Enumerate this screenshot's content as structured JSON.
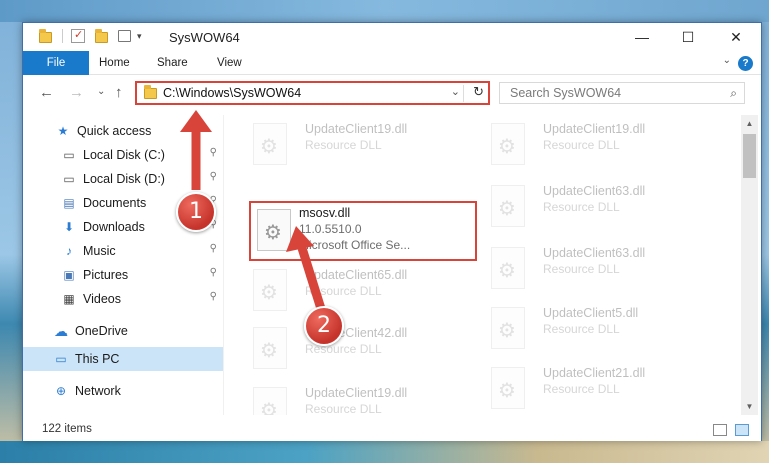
{
  "window": {
    "title": "SysWOW64",
    "minimize": "—",
    "maximize": "☐",
    "close": "✕"
  },
  "ribbon": {
    "tabs": [
      "File",
      "Home",
      "Share",
      "View"
    ],
    "help": "?"
  },
  "navigation": {
    "back": "←",
    "forward": "→",
    "recent": "⌄",
    "up": "↑",
    "address": "C:\\Windows\\SysWOW64",
    "address_dropdown": "⌄",
    "refresh": "↻",
    "search_placeholder": "Search SysWOW64",
    "search_icon": "⌕"
  },
  "sidebar": {
    "items": [
      {
        "label": "Quick access",
        "icon": "star-icon",
        "glyph": "★",
        "pinned": false
      },
      {
        "label": "Local Disk (C:)",
        "icon": "drive-icon",
        "glyph": "▭",
        "pinned": true
      },
      {
        "label": "Local Disk (D:)",
        "icon": "drive-icon",
        "glyph": "▭",
        "pinned": true
      },
      {
        "label": "Documents",
        "icon": "documents-icon",
        "glyph": "▤",
        "pinned": true
      },
      {
        "label": "Downloads",
        "icon": "downloads-icon",
        "glyph": "⬇",
        "pinned": true
      },
      {
        "label": "Music",
        "icon": "music-icon",
        "glyph": "♪",
        "pinned": true
      },
      {
        "label": "Pictures",
        "icon": "pictures-icon",
        "glyph": "▣",
        "pinned": true
      },
      {
        "label": "Videos",
        "icon": "videos-icon",
        "glyph": "▦",
        "pinned": true
      },
      {
        "label": "OneDrive",
        "icon": "cloud-icon",
        "glyph": "☁",
        "pinned": false
      },
      {
        "label": "This PC",
        "icon": "computer-icon",
        "glyph": "▭",
        "pinned": false
      },
      {
        "label": "Network",
        "icon": "network-icon",
        "glyph": "⊕",
        "pinned": false
      }
    ],
    "pin_glyph": "📌"
  },
  "files": {
    "left_column": [
      {
        "name": "UpdateClient19.dll",
        "sub": "Resource DLL",
        "faded": true
      },
      {
        "name": "msosv.dll",
        "sub": "11.0.5510.0",
        "sub2": "Microsoft Office Se...",
        "faded": false,
        "highlighted": true
      },
      {
        "name": "UpdateClient65.dll",
        "sub": "Resource DLL",
        "faded": true
      },
      {
        "name": "UpdateClient42.dll",
        "sub": "Resource DLL",
        "faded": true
      },
      {
        "name": "UpdateClient19.dll",
        "sub": "Resource DLL",
        "faded": true
      }
    ],
    "right_column": [
      {
        "name": "UpdateClient19.dll",
        "sub": "Resource DLL",
        "faded": true
      },
      {
        "name": "UpdateClient63.dll",
        "sub": "Resource DLL",
        "faded": true
      },
      {
        "name": "UpdateClient63.dll",
        "sub": "Resource DLL",
        "faded": true
      },
      {
        "name": "UpdateClient5.dll",
        "sub": "Resource DLL",
        "faded": true
      },
      {
        "name": "UpdateClient21.dll",
        "sub": "Resource DLL",
        "faded": true
      }
    ]
  },
  "status": {
    "item_count": "122 items"
  },
  "annotations": {
    "step1": "1",
    "step2": "2",
    "color": "#d9443a"
  }
}
